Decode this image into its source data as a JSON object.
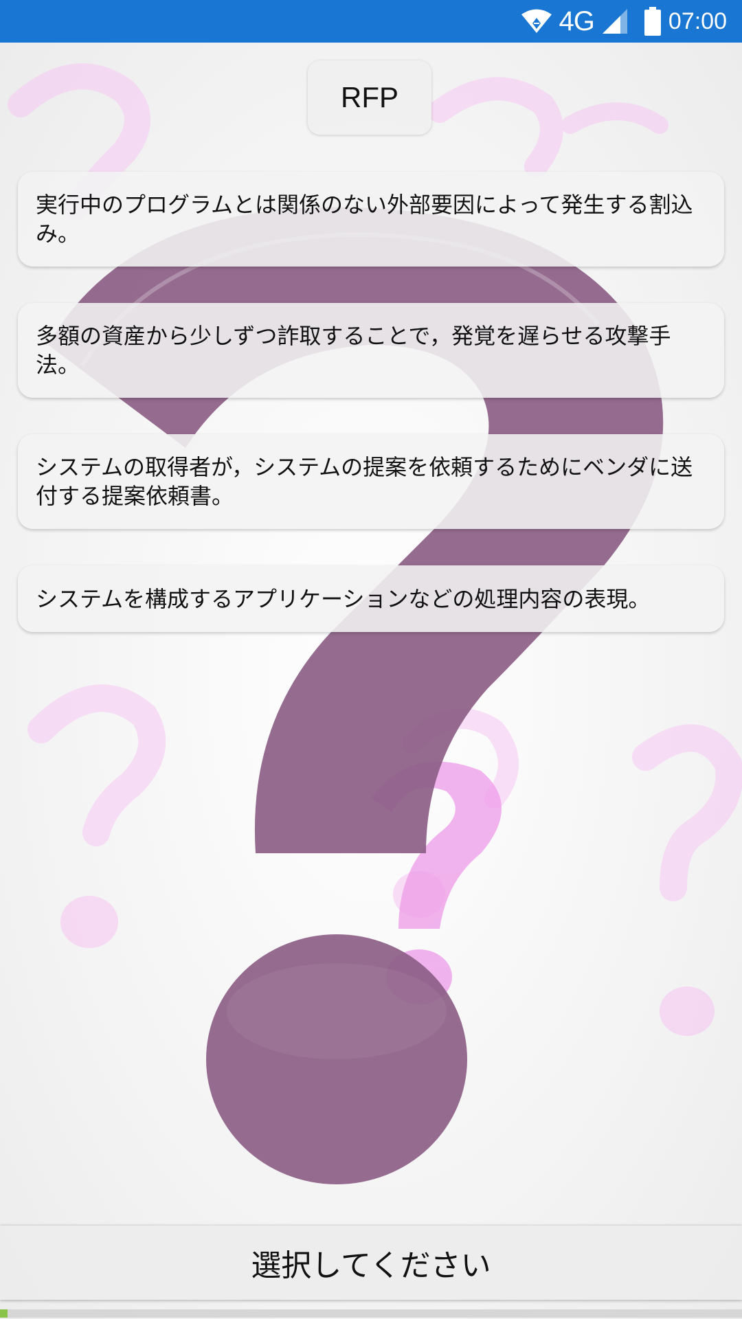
{
  "status_bar": {
    "network": "4G",
    "time": "07:00",
    "icons": [
      "wifi-icon",
      "signal-icon",
      "battery-icon"
    ]
  },
  "question": {
    "term": "RFP"
  },
  "options": [
    {
      "text": "実行中のプログラムとは関係のない外部要因によって発生する割込み。"
    },
    {
      "text": "多額の資産から少しずつ詐取することで，発覚を遅らせる攻撃手法。"
    },
    {
      "text": "システムの取得者が，システムの提案を依頼するためにベンダに送付する提案依頼書。"
    },
    {
      "text": "システムを構成するアプリケーションなどの処理内容の表現。"
    }
  ],
  "select_prompt": "選択してください",
  "progress": {
    "fraction": 0.01
  },
  "colors": {
    "status_bar": "#1976d2",
    "question_mark_main": "#8c5e86",
    "question_mark_bg": "#f2b8ef",
    "progress": "#8bc34a"
  }
}
